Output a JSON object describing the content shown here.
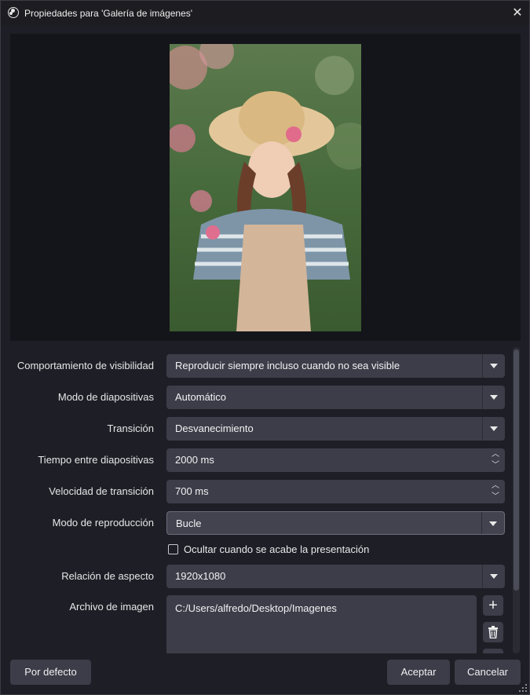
{
  "window": {
    "title": "Propiedades para 'Galería de imágenes'"
  },
  "properties": {
    "visibility": {
      "label": "Comportamiento de visibilidad",
      "value": "Reproducir siempre incluso cuando no sea visible"
    },
    "slide_mode": {
      "label": "Modo de diapositivas",
      "value": "Automático"
    },
    "transition": {
      "label": "Transición",
      "value": "Desvanecimiento"
    },
    "slide_time": {
      "label": "Tiempo entre diapositivas",
      "value": "2000 ms"
    },
    "transition_speed": {
      "label": "Velocidad de transición",
      "value": "700 ms"
    },
    "playback_mode": {
      "label": "Modo de reproducción",
      "value": "Bucle"
    },
    "hide_when_done": {
      "label": "Ocultar cuando se acabe la presentación",
      "checked": false
    },
    "aspect_ratio": {
      "label": "Relación de aspecto",
      "value": "1920x1080"
    },
    "image_files": {
      "label": "Archivo de imagen",
      "items": [
        "C:/Users/alfredo/Desktop/Imagenes"
      ]
    }
  },
  "buttons": {
    "defaults": "Por defecto",
    "accept": "Aceptar",
    "cancel": "Cancelar"
  },
  "colors": {
    "background": "#1e1f26",
    "preview_bg": "#14151a",
    "control": "#3c3d48"
  }
}
